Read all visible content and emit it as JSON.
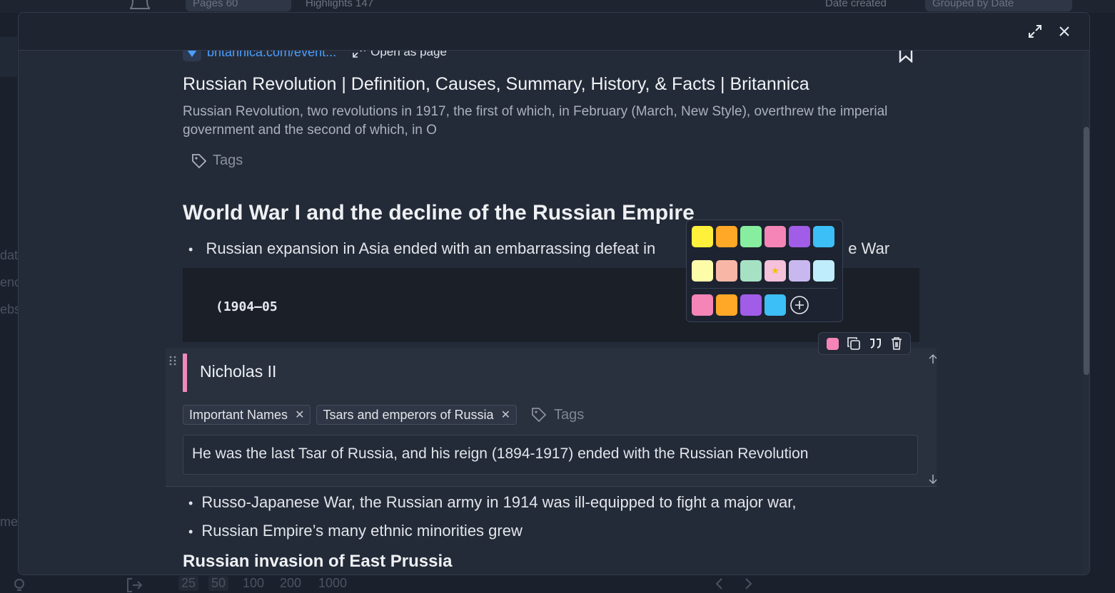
{
  "background": {
    "tabs": {
      "pages_label": "Pages",
      "pages_count": "60",
      "highlights_label": "Highlights",
      "highlights_count": "147",
      "date_created": "Date created",
      "grouped": "Grouped by Date"
    },
    "sidebar_fragments": [
      "dat",
      "enc",
      "ebs",
      "me"
    ],
    "pagination": [
      "25",
      "50",
      "100",
      "200",
      "1000"
    ]
  },
  "modal": {
    "source": {
      "domain": "britannica.com/event...",
      "open_as_page": "Open as page"
    },
    "title": "Russian Revolution | Definition, Causes, Summary, History, & Facts | Britannica",
    "description": "Russian Revolution, two revolutions in 1917, the first of which, in February (March, New Style), overthrew the imperial government and the second of which, in O",
    "tags_placeholder": "Tags",
    "content": {
      "heading": "World War I and the decline of the Russian Empire",
      "bullet_1_start": "Russian expansion in Asia ended with an embarrassing defeat in",
      "bullet_1_end": "e War",
      "code": "(1904–05",
      "bullet_2": "Russo-Japanese War, the Russian army in 1914 was ill-equipped to fight a major war,",
      "bullet_3": "Russian Empire’s many ethnic minorities grew",
      "heading_2": "Russian invasion of East Prussia"
    },
    "highlight": {
      "text": "Nicholas II",
      "color": "#f08ab8",
      "tags": [
        "Important Names",
        "Tsars and emperors of Russia"
      ],
      "tags_placeholder": "Tags",
      "note": "He was the last Tsar of Russia, and his reign (1894-1917) ended with the Russian Revolution"
    },
    "palette": {
      "row1": [
        "#fef03b",
        "#ffa726",
        "#86ee9e",
        "#f585b6",
        "#a15ce8",
        "#3cbef7"
      ],
      "row2": [
        "#fdfca9",
        "#f8b7a6",
        "#a6e1c4",
        "#f6c1da",
        "#c9b8ef",
        "#bfedfb"
      ],
      "row3": [
        "#f585b6",
        "#ffa726",
        "#a15ce8",
        "#3cbef7"
      ],
      "selected_marker": "★"
    }
  }
}
